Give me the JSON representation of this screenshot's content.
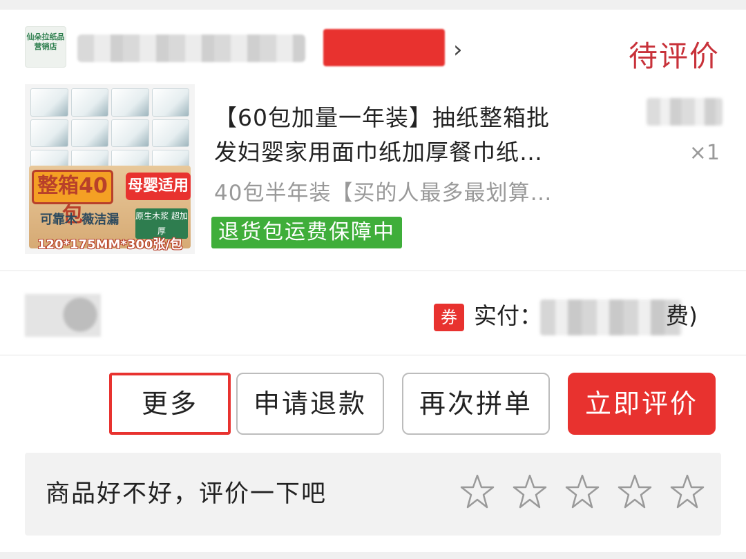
{
  "shop": {
    "logo_text": "仙朵拉纸品营销店",
    "status": "待评价"
  },
  "product": {
    "title_line1": "【60包加量一年装】抽纸整箱批",
    "title_line2": "发妇婴家用面巾纸加厚餐巾纸…",
    "quantity": "×1",
    "sku": "40包半年装【买的人最多最划算…",
    "guarantee": "退货包运费保障中",
    "image": {
      "badge_main": "整箱40包",
      "badge_side": "母婴适用",
      "brand": "可靠木 薇洁漏",
      "side_text": "原生木浆 超加厚",
      "spec": "120*175MM*300张/包"
    }
  },
  "payment": {
    "coupon_icon": "券",
    "paid_label": "实付：",
    "paid_suffix": "费)"
  },
  "actions": {
    "more": "更多",
    "refund": "申请退款",
    "reorder": "再次拼单",
    "review": "立即评价"
  },
  "rating": {
    "prompt": "商品好不好，评价一下吧",
    "stars_total": 5,
    "stars_selected": 0
  },
  "colors": {
    "accent_red": "#e8322f",
    "status_red": "#c8323a",
    "guarantee_green": "#3fae3a"
  }
}
